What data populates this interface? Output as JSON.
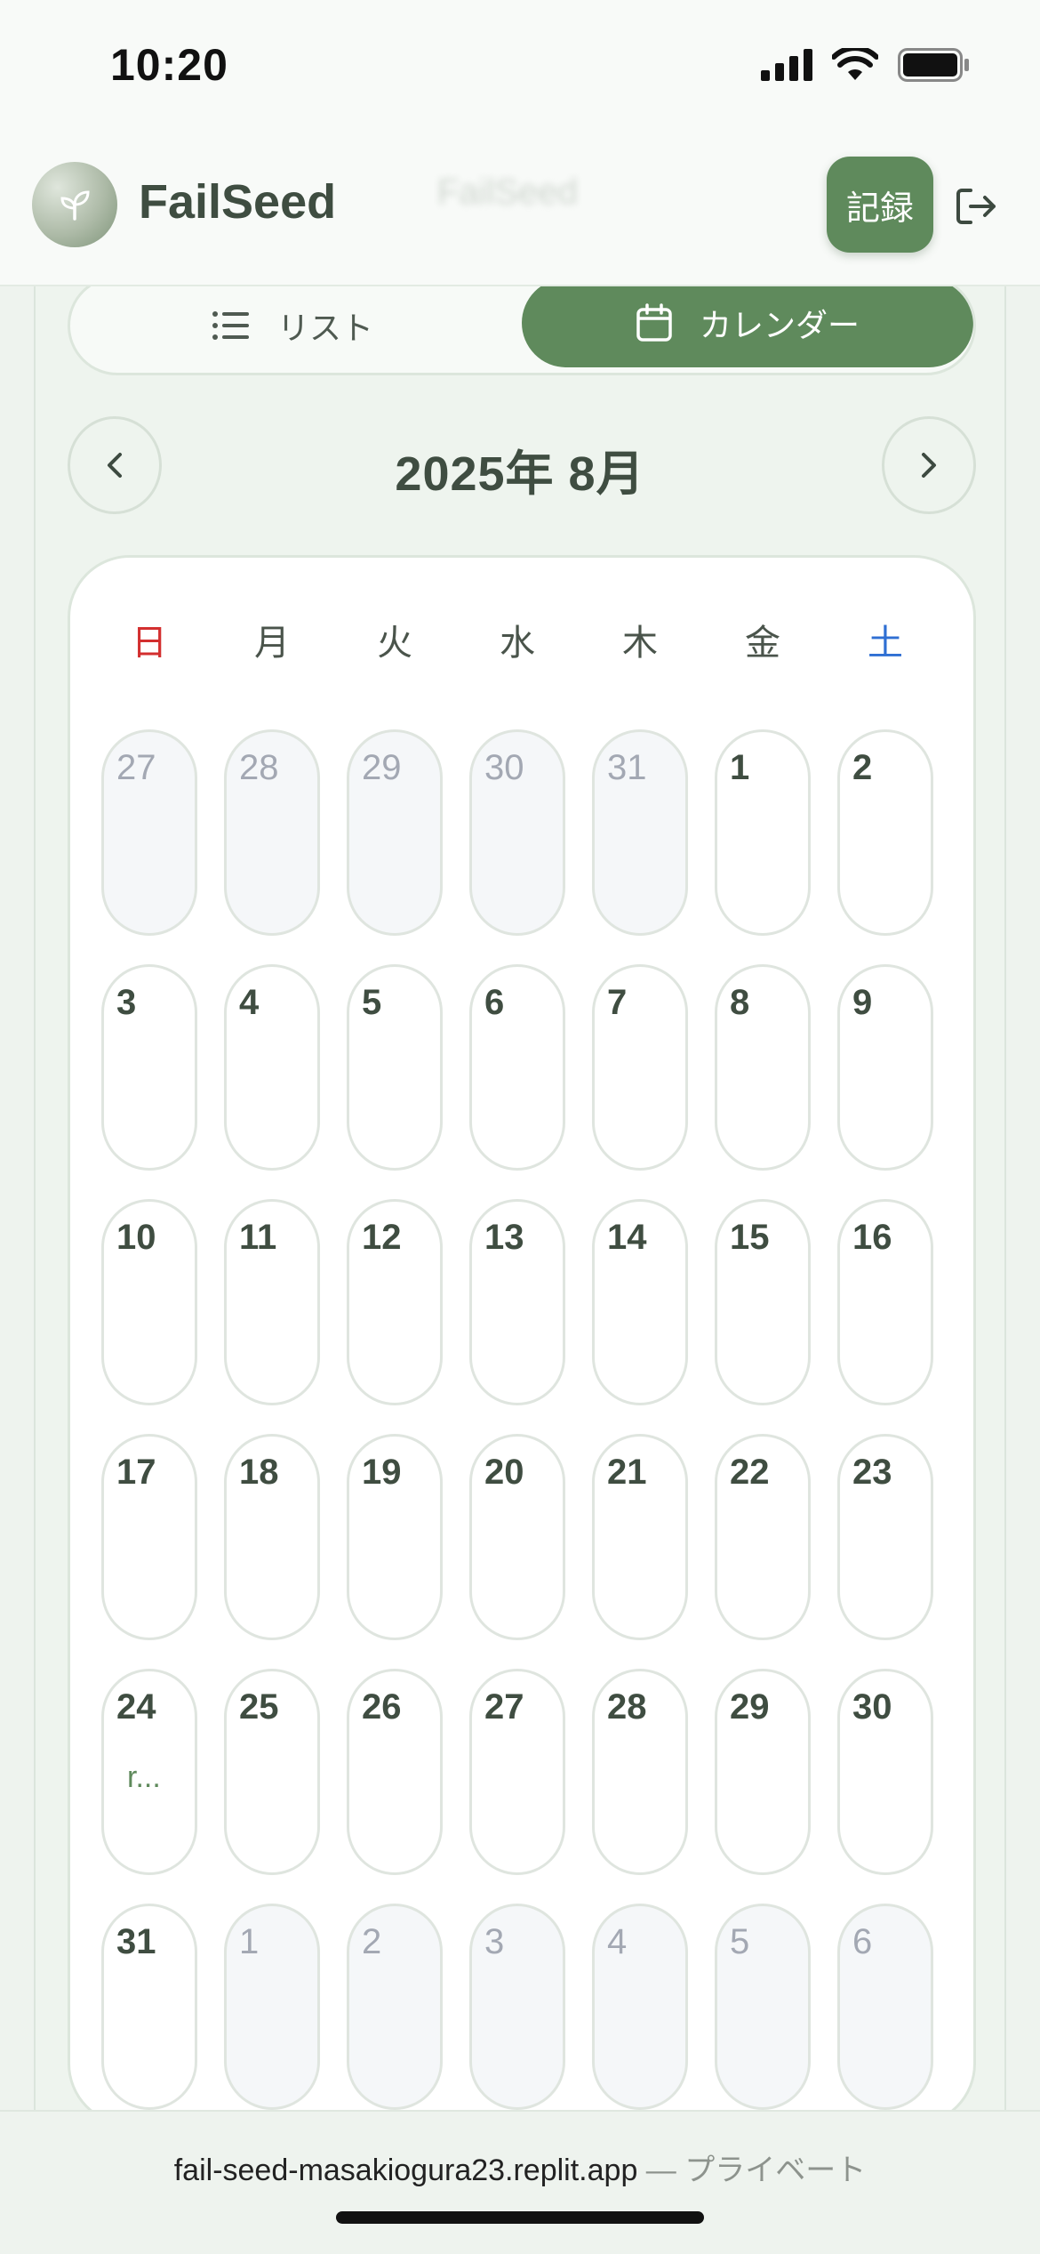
{
  "status_bar": {
    "time": "10:20"
  },
  "header": {
    "app_name": "FailSeed",
    "ghost_title": "FailSeed",
    "record_label": "記録"
  },
  "view_toggle": {
    "list_label": "リスト",
    "calendar_label": "カレンダー",
    "active": "calendar"
  },
  "calendar": {
    "month_title": "2025年 8月",
    "weekdays": [
      "日",
      "月",
      "火",
      "水",
      "木",
      "金",
      "土"
    ],
    "weeks": [
      [
        {
          "d": "27",
          "out": true
        },
        {
          "d": "28",
          "out": true
        },
        {
          "d": "29",
          "out": true
        },
        {
          "d": "30",
          "out": true
        },
        {
          "d": "31",
          "out": true
        },
        {
          "d": "1",
          "out": false
        },
        {
          "d": "2",
          "out": false
        }
      ],
      [
        {
          "d": "3",
          "out": false
        },
        {
          "d": "4",
          "out": false
        },
        {
          "d": "5",
          "out": false
        },
        {
          "d": "6",
          "out": false
        },
        {
          "d": "7",
          "out": false
        },
        {
          "d": "8",
          "out": false
        },
        {
          "d": "9",
          "out": false
        }
      ],
      [
        {
          "d": "10",
          "out": false
        },
        {
          "d": "11",
          "out": false
        },
        {
          "d": "12",
          "out": false
        },
        {
          "d": "13",
          "out": false
        },
        {
          "d": "14",
          "out": false
        },
        {
          "d": "15",
          "out": false
        },
        {
          "d": "16",
          "out": false
        }
      ],
      [
        {
          "d": "17",
          "out": false
        },
        {
          "d": "18",
          "out": false
        },
        {
          "d": "19",
          "out": false
        },
        {
          "d": "20",
          "out": false
        },
        {
          "d": "21",
          "out": false
        },
        {
          "d": "22",
          "out": false
        },
        {
          "d": "23",
          "out": false
        }
      ],
      [
        {
          "d": "24",
          "out": false,
          "event": "r..."
        },
        {
          "d": "25",
          "out": false
        },
        {
          "d": "26",
          "out": false
        },
        {
          "d": "27",
          "out": false
        },
        {
          "d": "28",
          "out": false
        },
        {
          "d": "29",
          "out": false
        },
        {
          "d": "30",
          "out": false
        }
      ],
      [
        {
          "d": "31",
          "out": false
        },
        {
          "d": "1",
          "out": true
        },
        {
          "d": "2",
          "out": true
        },
        {
          "d": "3",
          "out": true
        },
        {
          "d": "4",
          "out": true
        },
        {
          "d": "5",
          "out": true
        },
        {
          "d": "6",
          "out": true
        }
      ]
    ]
  },
  "url_bar": {
    "domain": "fail-seed-masakiogura23.replit.app",
    "privacy": " — プライベート"
  },
  "colors": {
    "accent": "#5f8a5c",
    "sunday": "#d32f2f",
    "saturday": "#2f6fd3"
  }
}
